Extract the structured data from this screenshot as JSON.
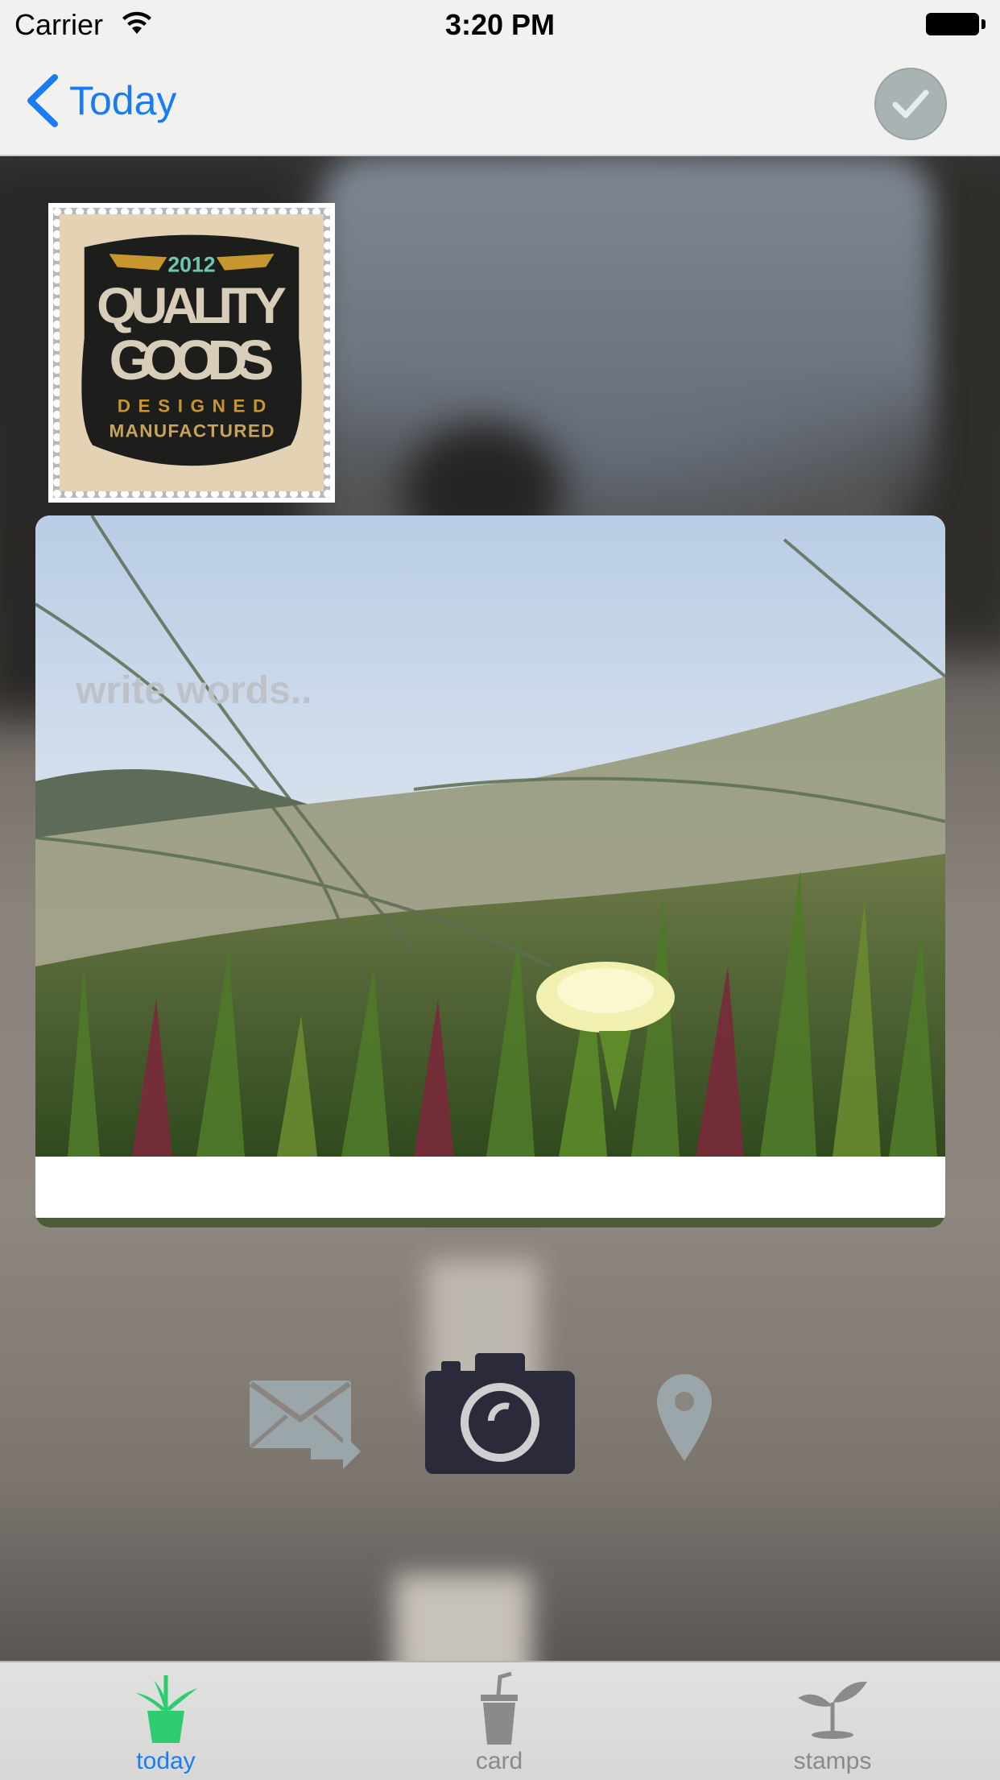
{
  "status_bar": {
    "carrier": "Carrier",
    "time": "3:20 PM"
  },
  "nav": {
    "back_label": "Today",
    "back_icon": "chevron-left-icon",
    "done_icon": "checkmark-icon"
  },
  "stamp": {
    "year": "2012",
    "line1": "QUALITY",
    "line2": "GOODS",
    "line3": "DESIGNED",
    "line4": "MANUFACTURED"
  },
  "card": {
    "text_placeholder": "write words.."
  },
  "actions": {
    "share_icon": "mail-share-icon",
    "camera_icon": "camera-icon",
    "location_icon": "location-pin-icon"
  },
  "tab_bar": {
    "tabs": [
      {
        "label": "today",
        "icon": "potted-plant-icon",
        "active": true
      },
      {
        "label": "card",
        "icon": "trash-can-icon",
        "active": false
      },
      {
        "label": "stamps",
        "icon": "sprout-icon",
        "active": false
      }
    ]
  },
  "colors": {
    "accent": "#1a7cf5",
    "active_tab_icon": "#2ecc71",
    "camera": "#2a2a3a",
    "muted_icon": "#9aa6aa"
  }
}
